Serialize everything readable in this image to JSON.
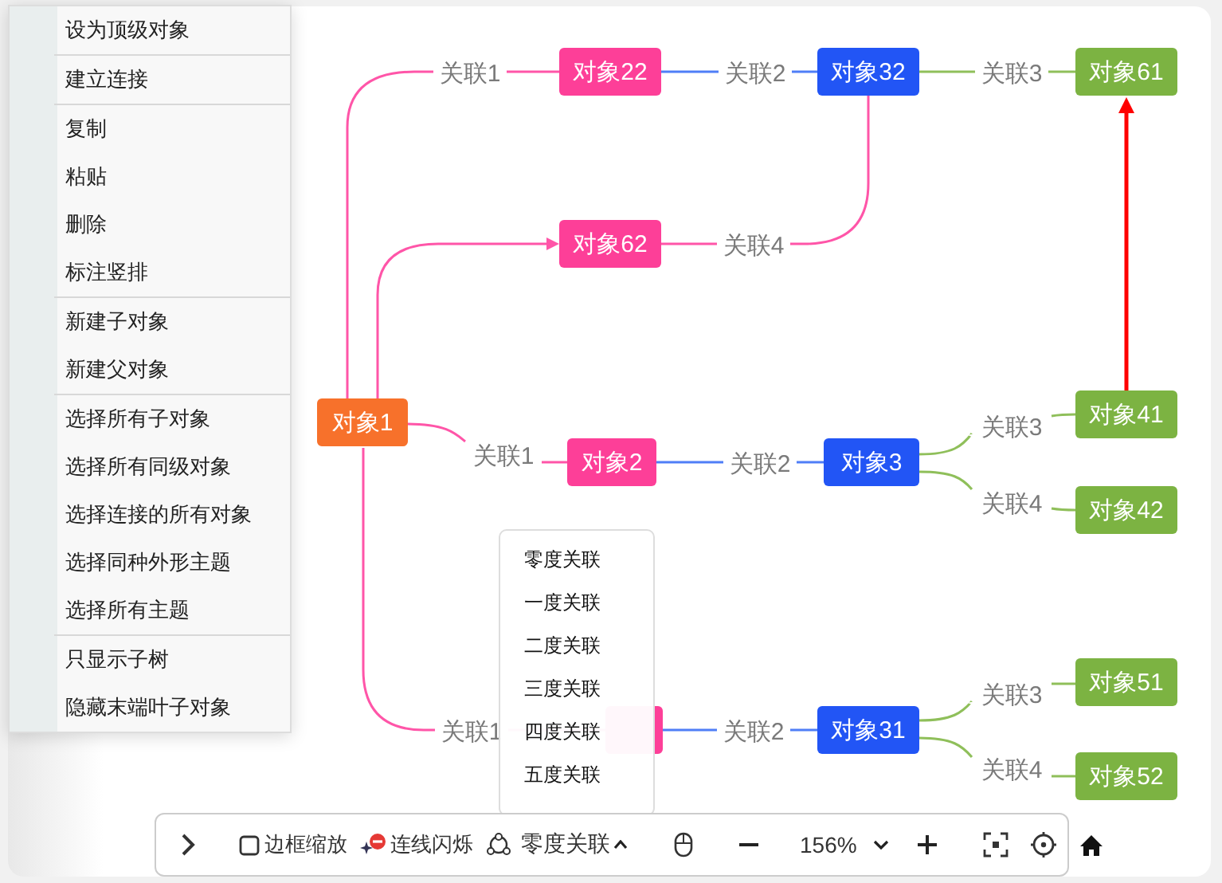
{
  "context_menu": {
    "groups": [
      {
        "items": [
          "设为顶级对象"
        ]
      },
      {
        "items": [
          "建立连接"
        ]
      },
      {
        "items": [
          "复制",
          "粘贴",
          "删除",
          "标注竖排"
        ]
      },
      {
        "items": [
          "新建子对象",
          "新建父对象"
        ]
      },
      {
        "items": [
          "选择所有子对象",
          "选择所有同级对象",
          "选择连接的所有对象",
          "选择同种外形主题",
          "选择所有主题"
        ]
      },
      {
        "items": [
          "只显示子树",
          "隐藏末端叶子对象"
        ]
      }
    ]
  },
  "graph": {
    "nodes": [
      {
        "label": "对象22",
        "color": "#fd3f98"
      },
      {
        "label": "对象32",
        "color": "#2255f5"
      },
      {
        "label": "对象61",
        "color": "#7cb342"
      },
      {
        "label": "对象62",
        "color": "#fd3f98"
      },
      {
        "label": "对象1",
        "color": "#f7712b"
      },
      {
        "label": "对象2",
        "color": "#fd3f98"
      },
      {
        "label": "对象3",
        "color": "#2255f5"
      },
      {
        "label": "对象41",
        "color": "#7cb342"
      },
      {
        "label": "对象42",
        "color": "#7cb342"
      },
      {
        "color": "#fd3f98"
      },
      {
        "label": "对象31",
        "color": "#2255f5"
      },
      {
        "label": "对象51",
        "color": "#7cb342"
      },
      {
        "label": "对象52",
        "color": "#7cb342"
      }
    ],
    "edges": [
      {
        "label": "关联1",
        "color": "#ff55a8"
      },
      {
        "label": "关联2",
        "color": "#4f7ef7"
      },
      {
        "label": "关联3",
        "color": "#8fbf5a"
      },
      {
        "color": "#ff55a8"
      },
      {
        "label": "关联4",
        "color": "#ff55a8"
      },
      {
        "label": "关联1",
        "color": "#ff55a8"
      },
      {
        "label": "关联2",
        "color": "#4f7ef7"
      },
      {
        "label": "关联3",
        "color": "#8fbf5a"
      },
      {
        "label": "关联4",
        "color": "#8fbf5a"
      },
      {
        "label": "关联1",
        "color": "#ff55a8"
      },
      {
        "label": "关联2",
        "color": "#4f7ef7"
      },
      {
        "label": "关联3",
        "color": "#8fbf5a"
      },
      {
        "label": "关联4",
        "color": "#8fbf5a"
      }
    ]
  },
  "association_dropdown": {
    "options": [
      "零度关联",
      "一度关联",
      "二度关联",
      "三度关联",
      "四度关联",
      "五度关联"
    ]
  },
  "toolbar": {
    "frame_zoom": "边框缩放",
    "line_flash": "连线闪烁",
    "association": "零度关联",
    "zoom": "156%"
  }
}
